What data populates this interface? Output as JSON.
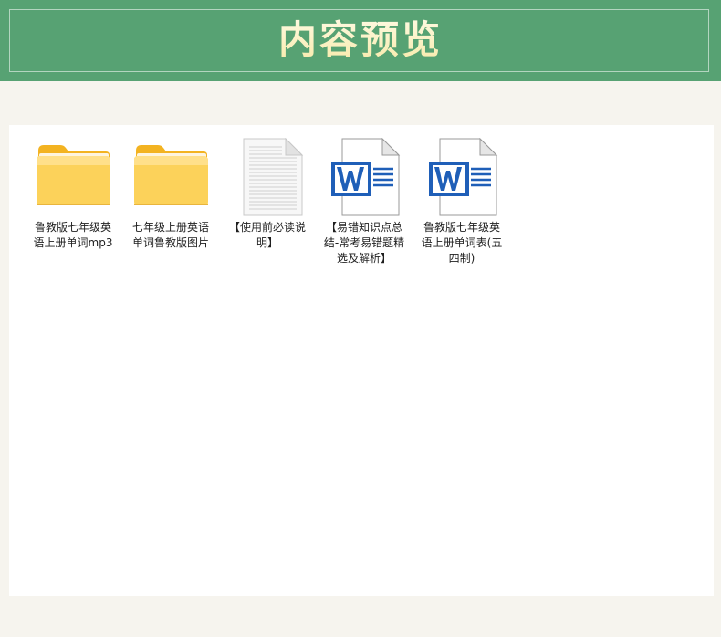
{
  "header": {
    "title": "内容预览"
  },
  "files": [
    {
      "name": "鲁教版七年级英语上册单词mp3",
      "icon": "folder-icon",
      "type": "folder"
    },
    {
      "name": "七年级上册英语单词鲁教版图片",
      "icon": "folder-icon",
      "type": "folder"
    },
    {
      "name": "【使用前必读说明】",
      "icon": "text-file-icon",
      "type": "text"
    },
    {
      "name": "【易错知识点总结-常考易错题精选及解析】",
      "icon": "word-file-icon",
      "type": "word"
    },
    {
      "name": "鲁教版七年级英语上册单词表(五四制)",
      "icon": "word-file-icon",
      "type": "word"
    }
  ],
  "colors": {
    "header_bg": "#57a273",
    "title": "#fbf2c8",
    "page_bg": "#f6f4ee",
    "panel_bg": "#ffffff",
    "folder": "#fcd25a",
    "word_blue": "#1f5fb8"
  }
}
